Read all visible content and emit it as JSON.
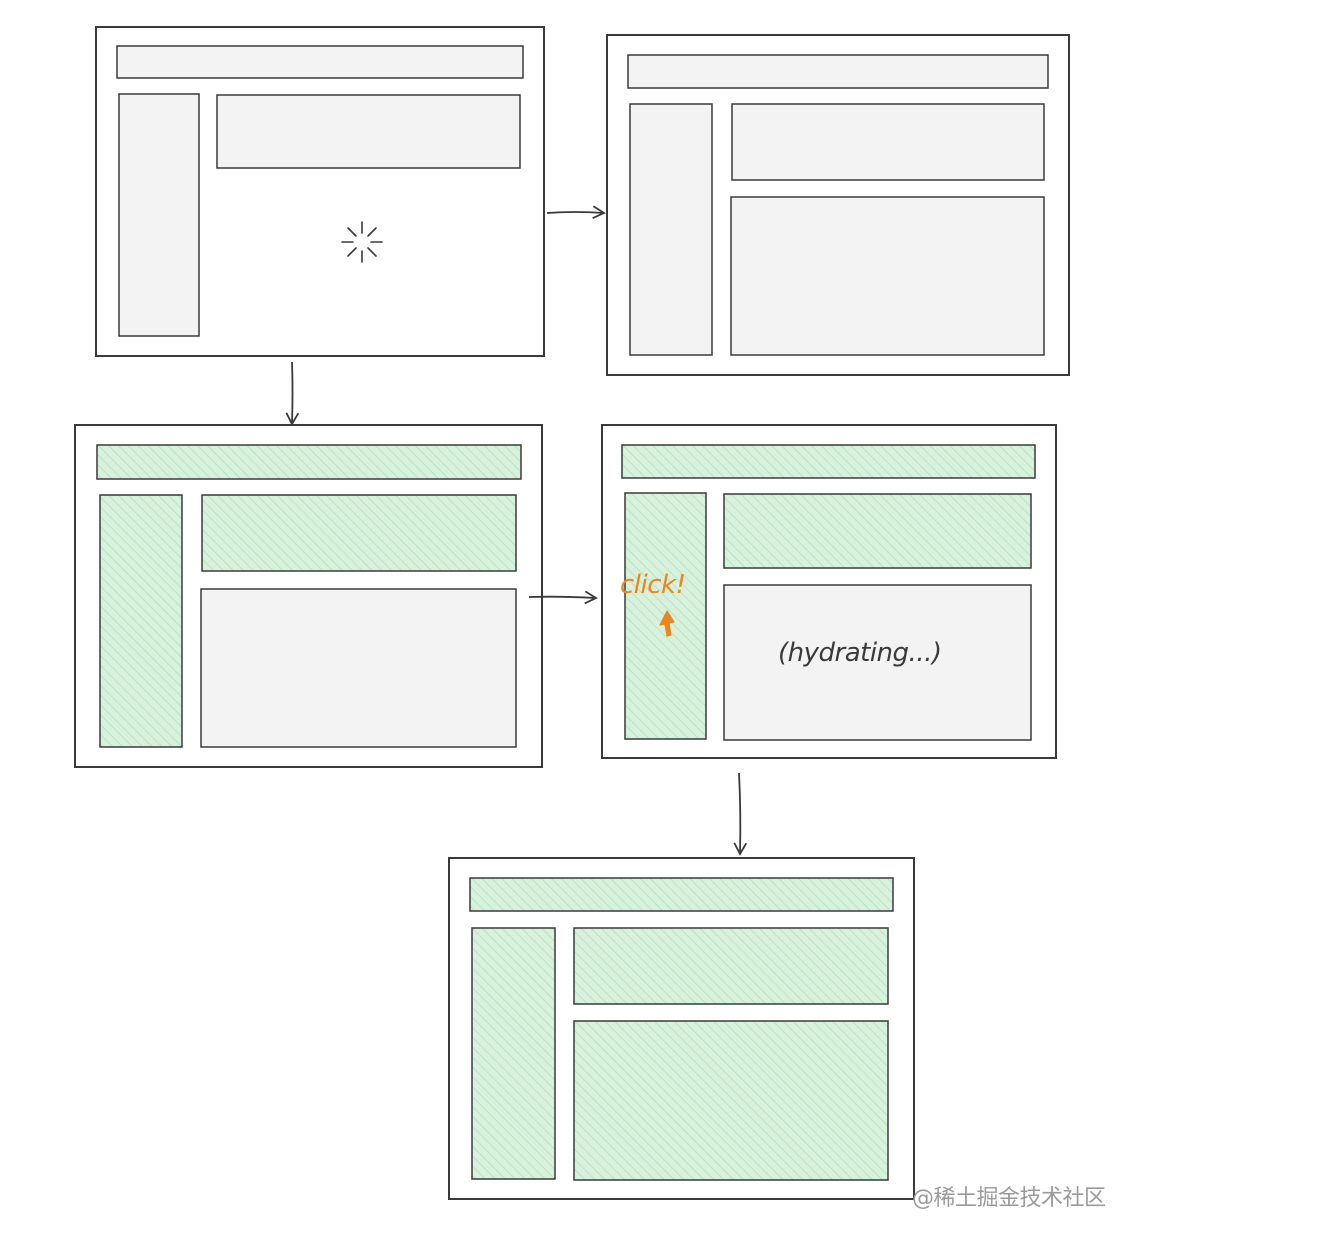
{
  "colors": {
    "stroke": "#3a3a3a",
    "empty_fill": "#f3f3f3",
    "hydrated_fill": "#d7f1dc",
    "hatch": "#b6dfbf",
    "click_accent": "#e8861f",
    "watermark": "#9a9a9a"
  },
  "annotations": {
    "click": "click!",
    "hydrating": "(hydrating...)"
  },
  "watermark": "@稀土掘金技术社区",
  "icons": {
    "loading": "spinner-icon",
    "cursor": "cursor-arrow-icon"
  },
  "stages": [
    {
      "name": "loading",
      "header": "empty",
      "sidebar": "empty",
      "top_panel": "empty",
      "main_panel": "spinner"
    },
    {
      "name": "server-rendered",
      "header": "empty",
      "sidebar": "empty",
      "top_panel": "empty",
      "main_panel": "empty"
    },
    {
      "name": "partially-hydrated",
      "header": "hydrated",
      "sidebar": "hydrated",
      "top_panel": "hydrated",
      "main_panel": "empty"
    },
    {
      "name": "user-click-while-hydrating",
      "header": "hydrated",
      "sidebar": "hydrated",
      "top_panel": "hydrated",
      "main_panel": "hydrating"
    },
    {
      "name": "fully-hydrated",
      "header": "hydrated",
      "sidebar": "hydrated",
      "top_panel": "hydrated",
      "main_panel": "hydrated"
    }
  ]
}
